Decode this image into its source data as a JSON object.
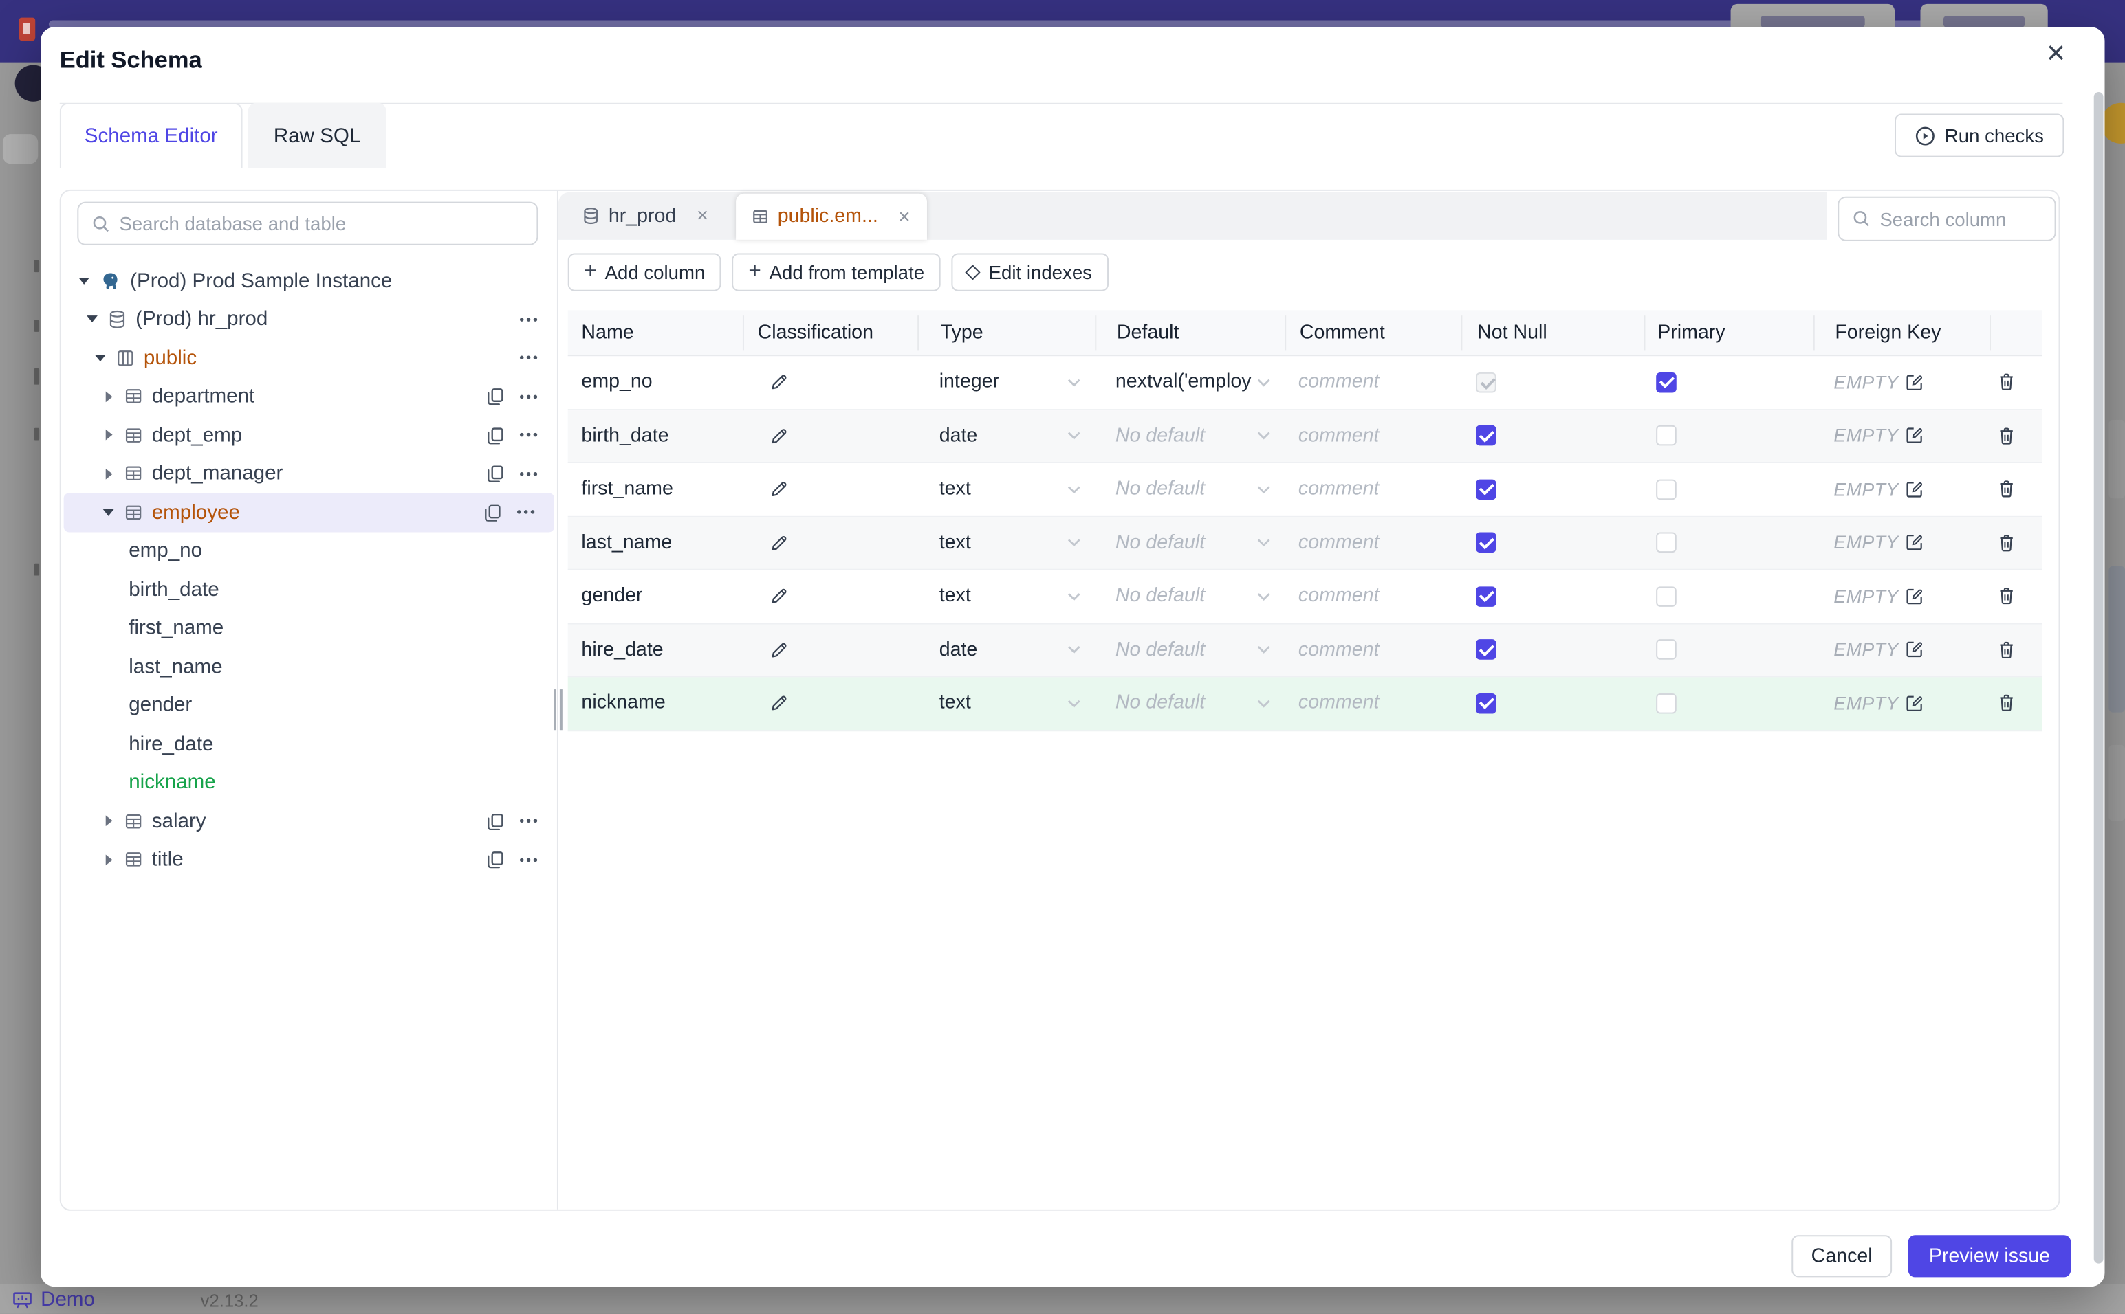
{
  "nav": {
    "demo_label": "Demo",
    "version": "v2.13.2"
  },
  "modal": {
    "title": "Edit Schema",
    "close_icon": "×",
    "tabs": [
      {
        "label": "Schema Editor"
      },
      {
        "label": "Raw SQL"
      }
    ],
    "run_checks_label": "Run checks"
  },
  "sidebar": {
    "search_placeholder": "Search database and table",
    "tree": [
      {
        "label": "(Prod) Prod Sample Instance"
      },
      {
        "label": "(Prod) hr_prod"
      },
      {
        "label": "public"
      },
      {
        "label": "department"
      },
      {
        "label": "dept_emp"
      },
      {
        "label": "dept_manager"
      },
      {
        "label": "employee"
      },
      {
        "label": "emp_no"
      },
      {
        "label": "birth_date"
      },
      {
        "label": "first_name"
      },
      {
        "label": "last_name"
      },
      {
        "label": "gender"
      },
      {
        "label": "hire_date"
      },
      {
        "label": "nickname"
      },
      {
        "label": "salary"
      },
      {
        "label": "title"
      }
    ]
  },
  "editor": {
    "tabs": [
      {
        "label": "hr_prod"
      },
      {
        "label": "public.em..."
      }
    ],
    "toolbar": {
      "add_column": "Add column",
      "add_from_template": "Add from template",
      "edit_indexes": "Edit indexes"
    },
    "search_placeholder": "Search column",
    "table": {
      "headers": [
        "Name",
        "Classification",
        "Type",
        "Default",
        "Comment",
        "Not Null",
        "Primary",
        "Foreign Key"
      ],
      "rows": [
        {
          "name": "emp_no",
          "type": "integer",
          "default": "nextval('employ",
          "comment": "comment",
          "not_null": "disabled",
          "primary": "checked",
          "foreign_key": "EMPTY"
        },
        {
          "name": "birth_date",
          "type": "date",
          "default": "No default",
          "comment": "comment",
          "not_null": "checked",
          "primary": "unchecked",
          "foreign_key": "EMPTY"
        },
        {
          "name": "first_name",
          "type": "text",
          "default": "No default",
          "comment": "comment",
          "not_null": "checked",
          "primary": "unchecked",
          "foreign_key": "EMPTY"
        },
        {
          "name": "last_name",
          "type": "text",
          "default": "No default",
          "comment": "comment",
          "not_null": "checked",
          "primary": "unchecked",
          "foreign_key": "EMPTY"
        },
        {
          "name": "gender",
          "type": "text",
          "default": "No default",
          "comment": "comment",
          "not_null": "checked",
          "primary": "unchecked",
          "foreign_key": "EMPTY"
        },
        {
          "name": "hire_date",
          "type": "date",
          "default": "No default",
          "comment": "comment",
          "not_null": "checked",
          "primary": "unchecked",
          "foreign_key": "EMPTY"
        },
        {
          "name": "nickname",
          "type": "text",
          "default": "No default",
          "comment": "comment",
          "not_null": "checked",
          "primary": "unchecked",
          "foreign_key": "EMPTY"
        }
      ]
    }
  },
  "footer": {
    "cancel_label": "Cancel",
    "preview_label": "Preview issue"
  },
  "colors": {
    "accent": "#4f46e5",
    "modified_amber": "#b45309",
    "new_green": "#16a34a",
    "nav_purple": "#363180",
    "selected_row": "#ecebfa",
    "new_row_bg": "#e9f8ef"
  }
}
